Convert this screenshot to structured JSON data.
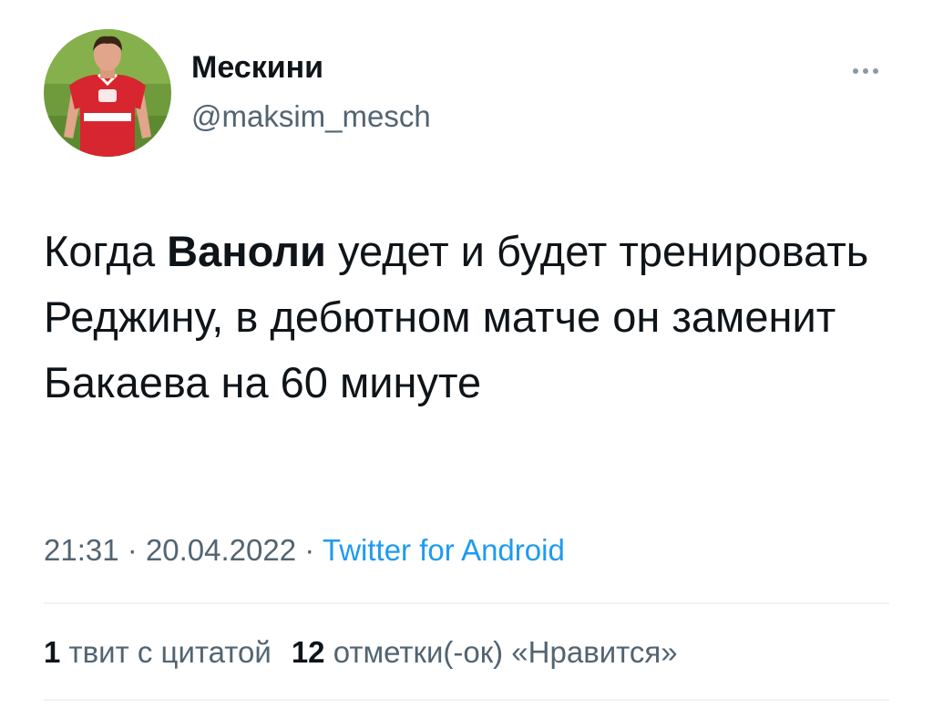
{
  "author": {
    "display_name": "Мескини",
    "handle": "@maksim_mesch",
    "avatar_icon": "avatar-photo-red-jersey"
  },
  "more_icon": "more-dots-icon",
  "tweet": {
    "text_before": "Когда ",
    "text_bold": "Ваноли",
    "text_after": " уедет и будет тренировать Реджину, в дебютном матче он заменит Бакаева на 60 минуте"
  },
  "meta": {
    "time": "21:31",
    "separator": "·",
    "date": "20.04.2022",
    "source": "Twitter for Android"
  },
  "stats": {
    "quotes_count": "1",
    "quotes_label": "твит с цитатой",
    "likes_count": "12",
    "likes_label": "отметки(-ок) «Нравится»"
  },
  "colors": {
    "text_primary": "#0f1419",
    "text_secondary": "#536471",
    "link": "#1d9bf0",
    "divider": "#eff3f4",
    "jersey_red": "#d7262f"
  }
}
